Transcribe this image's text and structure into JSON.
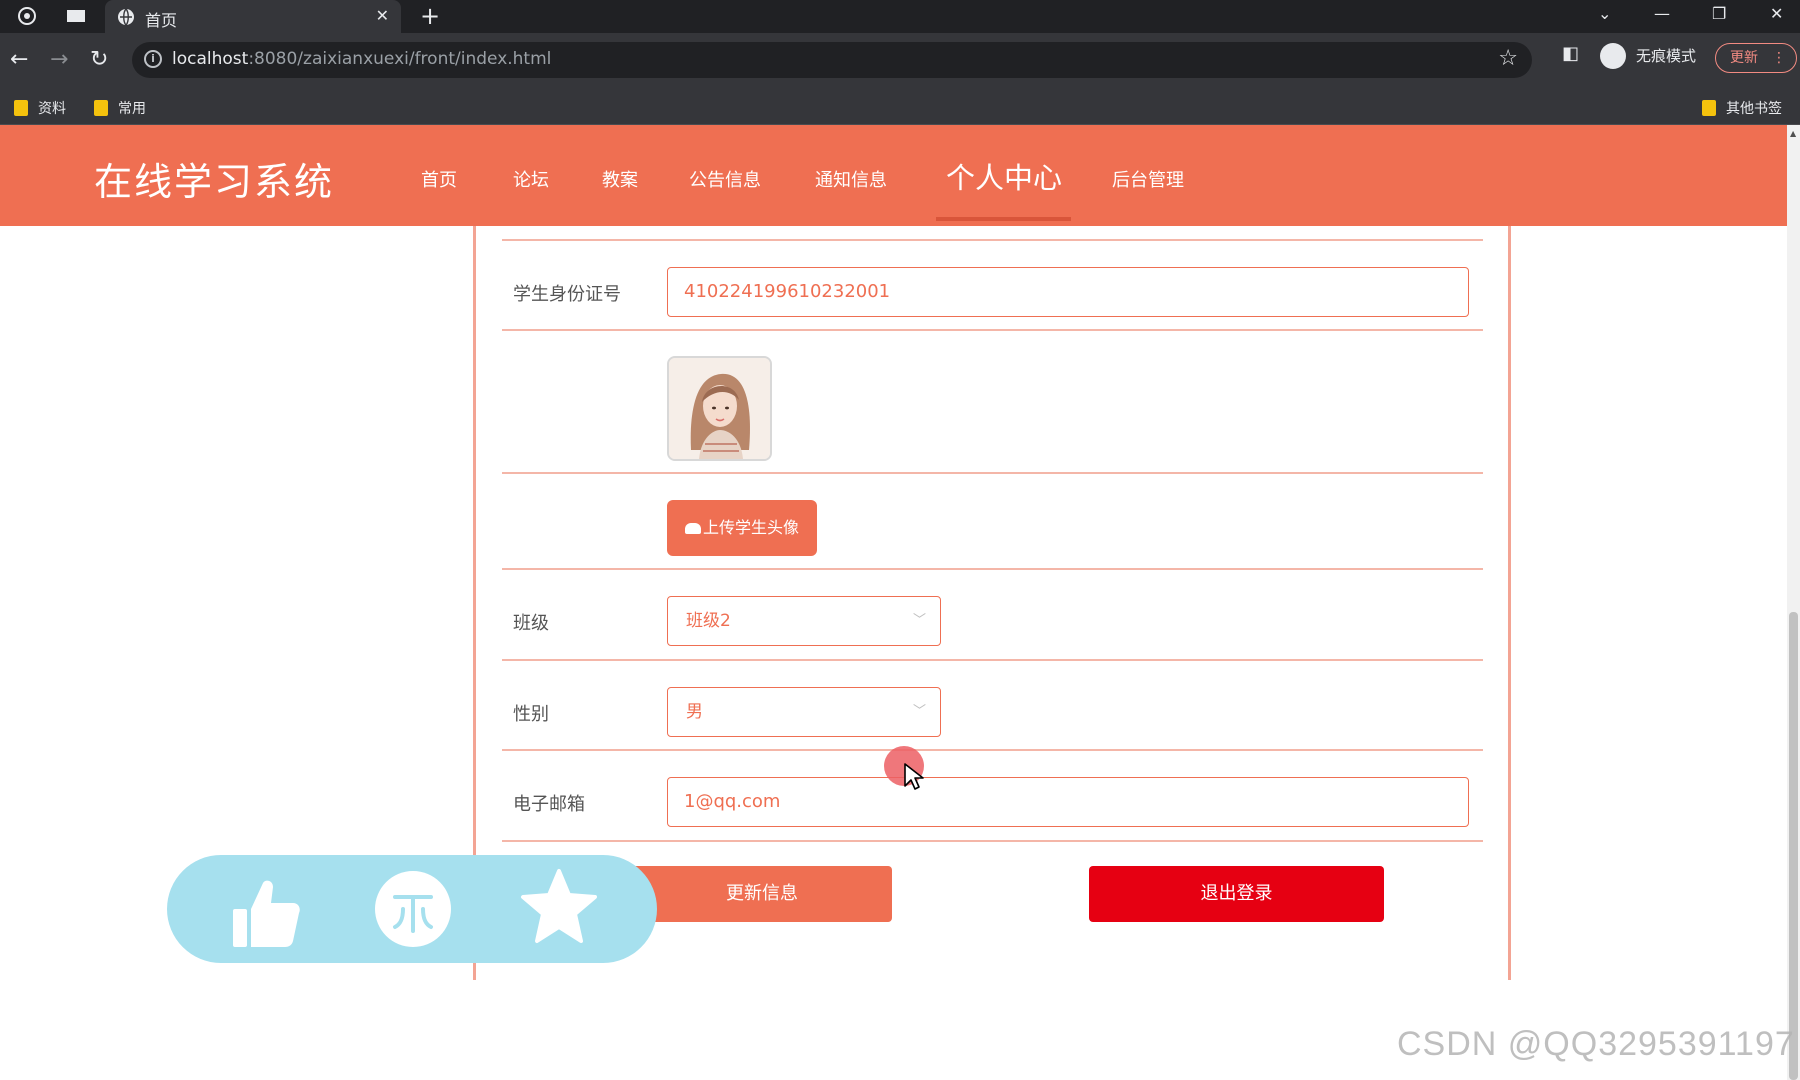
{
  "browser": {
    "tab_title": "首页",
    "url_host": "localhost",
    "url_rest": ":8080/zaixianxuexi/front/index.html",
    "incognito_label": "无痕模式",
    "update_label": "更新",
    "bookmarks": [
      "资料",
      "常用"
    ],
    "other_bookmarks": "其他书签"
  },
  "site": {
    "title": "在线学习系统",
    "nav": [
      "首页",
      "论坛",
      "教案",
      "公告信息",
      "通知信息",
      "个人中心",
      "后台管理"
    ],
    "active_nav": "个人中心"
  },
  "form": {
    "id_label": "学生身份证号",
    "id_value": "410224199610232001",
    "upload_label": "上传学生头像",
    "class_label": "班级",
    "class_value": "班级2",
    "gender_label": "性别",
    "gender_value": "男",
    "email_label": "电子邮箱",
    "email_value": "1@qq.com",
    "update_button": "更新信息",
    "logout_button": "退出登录"
  },
  "overlay": {
    "icons": [
      "thumbs-up-icon",
      "coin-icon",
      "star-icon"
    ],
    "color": "#a6e0ee"
  },
  "watermark": "CSDN @QQ3295391197",
  "colors": {
    "brand": "#ef6f52",
    "danger": "#e60012"
  }
}
